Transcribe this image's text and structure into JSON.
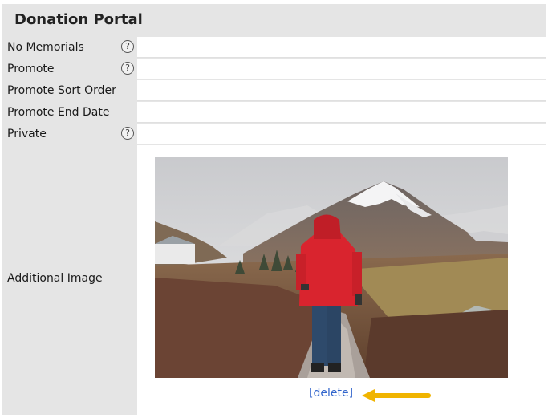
{
  "header": {
    "title": "Donation Portal"
  },
  "rows": [
    {
      "label": "No Memorials",
      "help": "?"
    },
    {
      "label": "Promote",
      "help": "?"
    },
    {
      "label": "Promote Sort Order"
    },
    {
      "label": "Promote End Date"
    },
    {
      "label": "Private",
      "help": "?"
    }
  ],
  "additional_image": {
    "label": "Additional Image",
    "delete_label": "[delete]"
  },
  "icons": {
    "help": "question-circle-icon",
    "annotation": "yellow-arrow-icon"
  },
  "colors": {
    "label_background": "#e5e5e5",
    "link": "#3366cc",
    "arrow": "#f0b400"
  }
}
